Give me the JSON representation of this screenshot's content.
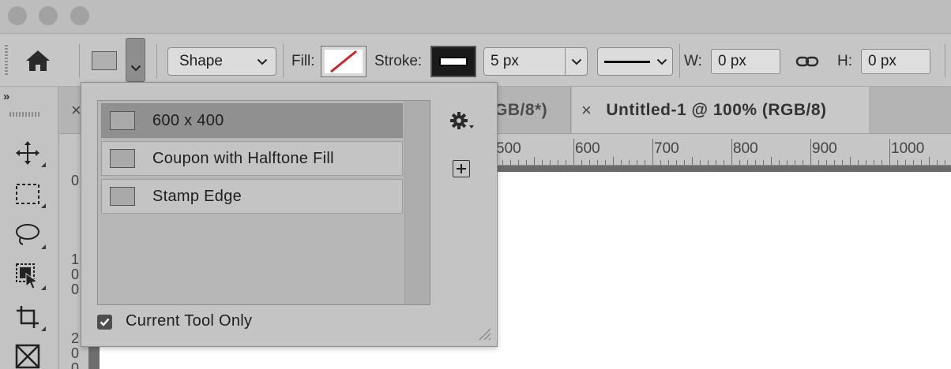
{
  "window": {
    "traffic_lights": [
      "close",
      "minimize",
      "zoom"
    ]
  },
  "options_bar": {
    "home_icon": "home-icon",
    "shape_mode": "Shape",
    "fill_label": "Fill:",
    "stroke_label": "Stroke:",
    "stroke_width": "5 px",
    "width_label": "W:",
    "width_value": "0 px",
    "height_label": "H:",
    "height_value": "0 px",
    "fill_swatch": {
      "state": "none",
      "slash_color": "#c8242a",
      "bg": "#ffffff"
    },
    "stroke_swatch": {
      "outer": "#000000",
      "inner": "#ffffff"
    }
  },
  "toolbar": {
    "collapse_glyph": "»",
    "tools": [
      "move-tool",
      "rectangular-marquee-tool",
      "lasso-tool",
      "object-selection-tool",
      "crop-tool",
      "frame-tool"
    ]
  },
  "document_tabs": [
    {
      "label": "GB/8*)",
      "close": "×",
      "active": false
    },
    {
      "label": "Untitled-1 @ 100% (RGB/8)",
      "close": "×",
      "active": true
    }
  ],
  "ruler": {
    "horizontal_labels": [
      "500",
      "600",
      "700",
      "800",
      "900",
      "1000"
    ],
    "vertical_labels": [
      "0",
      "1",
      "0",
      "0",
      "2",
      "0",
      "0"
    ]
  },
  "preset_popup": {
    "presets": [
      {
        "label": "600 x 400",
        "selected": true
      },
      {
        "label": "Coupon with Halftone Fill",
        "selected": false
      },
      {
        "label": "Stamp Edge",
        "selected": false
      }
    ],
    "gear_icon": "gear-icon",
    "new_preset_icon": "new-preset-icon",
    "current_tool_only_label": "Current Tool Only",
    "current_tool_only_checked": true
  }
}
